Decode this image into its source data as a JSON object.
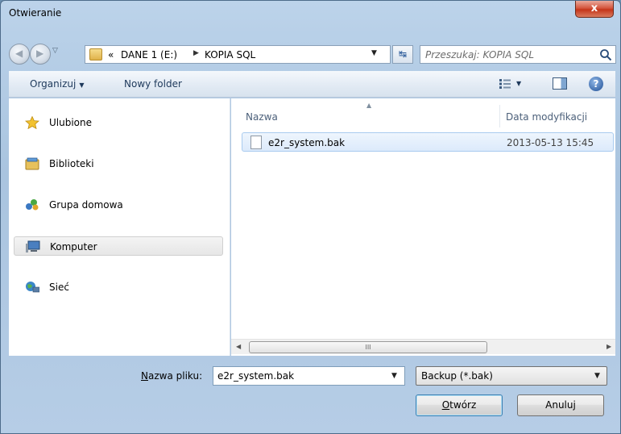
{
  "window": {
    "title": "Otwieranie",
    "close_label": "x"
  },
  "address": {
    "crumbs_prefix": "«",
    "crumbs": [
      "DANE 1 (E:)",
      "KOPIA SQL"
    ],
    "separator": "▶"
  },
  "search": {
    "placeholder": "Przeszukaj: KOPIA SQL"
  },
  "toolbar": {
    "organize_label": "Organizuj",
    "new_folder_label": "Nowy folder",
    "help_label": "?"
  },
  "nav_pane": {
    "items": [
      {
        "label": "Ulubione",
        "icon": "star-icon"
      },
      {
        "label": "Biblioteki",
        "icon": "library-icon"
      },
      {
        "label": "Grupa domowa",
        "icon": "homegroup-icon"
      },
      {
        "label": "Komputer",
        "icon": "computer-icon"
      },
      {
        "label": "Sieć",
        "icon": "network-icon"
      }
    ],
    "selected_index": 3
  },
  "file_list": {
    "columns": [
      "Nazwa",
      "Data modyfikacji"
    ],
    "rows": [
      {
        "name": "e2r_system.bak",
        "modified": "2013-05-13 15:45"
      }
    ]
  },
  "scrollbar": {
    "grip": "III"
  },
  "bottom": {
    "filename_label_prefix": "N",
    "filename_label_rest": "azwa pliku:",
    "filename_value": "e2r_system.bak",
    "filetype_value": "Backup (*.bak)",
    "open_label_first": "O",
    "open_label_rest": "twórz",
    "cancel_label": "Anuluj"
  },
  "colors": {
    "accent": "#3c7fb1",
    "selection": "#dceafb",
    "close": "#c43519"
  }
}
